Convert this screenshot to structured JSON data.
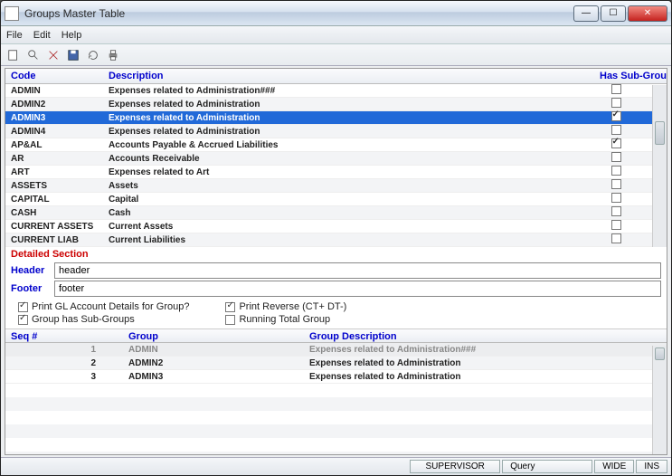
{
  "window": {
    "title": "Groups Master Table"
  },
  "menu": {
    "file": "File",
    "edit": "Edit",
    "help": "Help"
  },
  "grid": {
    "headers": {
      "code": "Code",
      "desc": "Description",
      "sub": "Has Sub-Groups"
    },
    "rows": [
      {
        "code": "ADMIN",
        "desc": "Expenses related to Administration###",
        "sub": false,
        "selected": false
      },
      {
        "code": "ADMIN2",
        "desc": "Expenses related to Administration",
        "sub": false,
        "selected": false
      },
      {
        "code": "ADMIN3",
        "desc": "Expenses related to Administration",
        "sub": true,
        "selected": true
      },
      {
        "code": "ADMIN4",
        "desc": "Expenses related to Administration",
        "sub": false,
        "selected": false
      },
      {
        "code": "AP&AL",
        "desc": "Accounts Payable & Accrued Liabilities",
        "sub": true,
        "selected": false
      },
      {
        "code": "AR",
        "desc": "Accounts Receivable",
        "sub": false,
        "selected": false
      },
      {
        "code": "ART",
        "desc": "Expenses related to Art",
        "sub": false,
        "selected": false
      },
      {
        "code": "ASSETS",
        "desc": "Assets",
        "sub": false,
        "selected": false
      },
      {
        "code": "CAPITAL",
        "desc": "Capital",
        "sub": false,
        "selected": false
      },
      {
        "code": "CASH",
        "desc": "Cash",
        "sub": false,
        "selected": false
      },
      {
        "code": "CURRENT ASSETS",
        "desc": "Current Assets",
        "sub": false,
        "selected": false
      },
      {
        "code": "CURRENT LIAB",
        "desc": "Current Liabilities",
        "sub": false,
        "selected": false
      }
    ]
  },
  "detail": {
    "section_label": "Detailed Section",
    "header_label": "Header",
    "header_value": "header",
    "footer_label": "Footer",
    "footer_value": "footer"
  },
  "checks": {
    "print_gl": {
      "label": "Print GL Account Details for Group?",
      "checked": true
    },
    "has_sub": {
      "label": "Group has Sub-Groups",
      "checked": true
    },
    "print_rev": {
      "label": "Print Reverse (CT+ DT-)",
      "checked": true
    },
    "running": {
      "label": "Running Total Group",
      "checked": false
    }
  },
  "subgrid": {
    "headers": {
      "seq": "Seq #",
      "group": "Group",
      "gdesc": "Group Description"
    },
    "rows": [
      {
        "seq": "1",
        "group": "ADMIN",
        "gdesc": "Expenses related to Administration###",
        "current": true
      },
      {
        "seq": "2",
        "group": "ADMIN2",
        "gdesc": "Expenses related to Administration",
        "current": false
      },
      {
        "seq": "3",
        "group": "ADMIN3",
        "gdesc": "Expenses related to Administration",
        "current": false
      }
    ]
  },
  "status": {
    "user": "SUPERVISOR",
    "mode": "Query",
    "wide": "WIDE",
    "ins": "INS"
  }
}
